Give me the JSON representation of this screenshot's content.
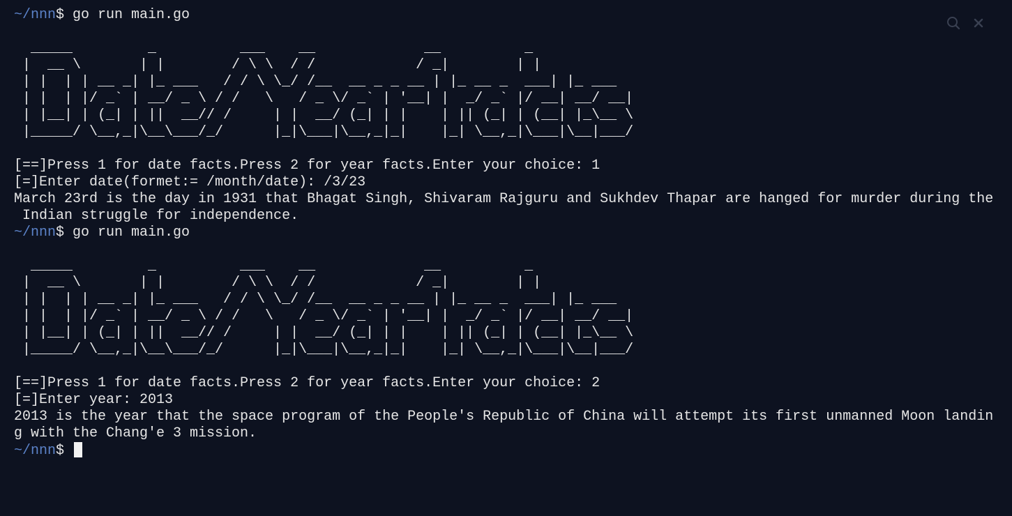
{
  "terminal": {
    "prompt_path": "~/nnn",
    "prompt_symbol": "$ ",
    "lines": [
      {
        "type": "prompt",
        "command": "go run main.go"
      },
      {
        "type": "blank",
        "text": ""
      },
      {
        "type": "ascii",
        "text": "  _____         _          ___    __             __          _"
      },
      {
        "type": "ascii",
        "text": " |  __ \\       | |        / \\ \\  / /            / _|        | |"
      },
      {
        "type": "ascii",
        "text": " | |  | | __ _| |_ ___   / / \\ \\_/ /__  __ _ _ __ | |_ __ _  ___| |_ ___"
      },
      {
        "type": "ascii",
        "text": " | |  | |/ _` | __/ _ \\ / /   \\   / _ \\/ _` | '__| |  _/ _` |/ __| __/ __|"
      },
      {
        "type": "ascii",
        "text": " | |__| | (_| | ||  __// /     | |  __/ (_| | |    | || (_| | (__| |_\\__ \\"
      },
      {
        "type": "ascii",
        "text": " |_____/ \\__,_|\\__\\___/_/      |_|\\___|\\__,_|_|    |_| \\__,_|\\___|\\__|___/"
      },
      {
        "type": "blank",
        "text": ""
      },
      {
        "type": "text",
        "text": "[==]Press 1 for date facts.Press 2 for year facts.Enter your choice: 1"
      },
      {
        "type": "text",
        "text": "[=]Enter date(formet:= /month/date): /3/23"
      },
      {
        "type": "text",
        "text": "March 23rd is the day in 1931 that Bhagat Singh, Shivaram Rajguru and Sukhdev Thapar are hanged for murder during the"
      },
      {
        "type": "text",
        "text": " Indian struggle for independence."
      },
      {
        "type": "prompt",
        "command": "go run main.go"
      },
      {
        "type": "blank",
        "text": ""
      },
      {
        "type": "ascii",
        "text": "  _____         _          ___    __             __          _"
      },
      {
        "type": "ascii",
        "text": " |  __ \\       | |        / \\ \\  / /            / _|        | |"
      },
      {
        "type": "ascii",
        "text": " | |  | | __ _| |_ ___   / / \\ \\_/ /__  __ _ _ __ | |_ __ _  ___| |_ ___"
      },
      {
        "type": "ascii",
        "text": " | |  | |/ _` | __/ _ \\ / /   \\   / _ \\/ _` | '__| |  _/ _` |/ __| __/ __|"
      },
      {
        "type": "ascii",
        "text": " | |__| | (_| | ||  __// /     | |  __/ (_| | |    | || (_| | (__| |_\\__ \\"
      },
      {
        "type": "ascii",
        "text": " |_____/ \\__,_|\\__\\___/_/      |_|\\___|\\__,_|_|    |_| \\__,_|\\___|\\__|___/"
      },
      {
        "type": "blank",
        "text": ""
      },
      {
        "type": "text",
        "text": "[==]Press 1 for date facts.Press 2 for year facts.Enter your choice: 2"
      },
      {
        "type": "text",
        "text": "[=]Enter year: 2013"
      },
      {
        "type": "text",
        "text": "2013 is the year that the space program of the People's Republic of China will attempt its first unmanned Moon landin"
      },
      {
        "type": "text",
        "text": "g with the Chang'e 3 mission."
      },
      {
        "type": "prompt",
        "command": "",
        "cursor": true
      }
    ]
  },
  "toolbar": {
    "search_icon": "search-icon",
    "close_icon": "close-icon"
  },
  "colors": {
    "background": "#0d1220",
    "text": "#e6e6e6",
    "prompt": "#5b82c8",
    "icon": "#3a4152"
  }
}
